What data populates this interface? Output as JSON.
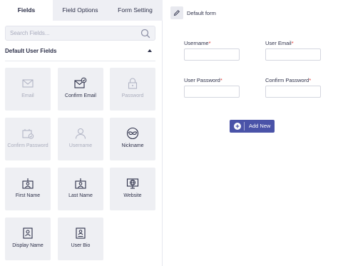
{
  "tabs": [
    {
      "label": "Fields",
      "active": true
    },
    {
      "label": "Field Options",
      "active": false
    },
    {
      "label": "Form Setting",
      "active": false
    }
  ],
  "search": {
    "placeholder": "Search Fields...",
    "value": "",
    "icon": "search-icon"
  },
  "section": {
    "title": "Default User Fields",
    "toggle_icon": "caret-up-icon"
  },
  "fields": [
    {
      "label": "Email",
      "icon": "envelope-icon",
      "disabled": true
    },
    {
      "label": "Confirm Email",
      "icon": "envelope-check-icon",
      "disabled": false
    },
    {
      "label": "Password",
      "icon": "lock-icon",
      "disabled": true
    },
    {
      "label": "Confirm Password",
      "icon": "id-card-check-icon",
      "disabled": true
    },
    {
      "label": "Username",
      "icon": "user-icon",
      "disabled": true
    },
    {
      "label": "Nickname",
      "icon": "mask-icon",
      "disabled": false
    },
    {
      "label": "First Name",
      "icon": "id-badge-icon",
      "disabled": false
    },
    {
      "label": "Last Name",
      "icon": "id-badge-icon",
      "disabled": false
    },
    {
      "label": "Website",
      "icon": "globe-monitor-icon",
      "disabled": false
    },
    {
      "label": "Display Name",
      "icon": "portrait-icon",
      "disabled": false
    },
    {
      "label": "User Bio",
      "icon": "bio-card-icon",
      "disabled": false
    }
  ],
  "form": {
    "name": "Default form",
    "edit_icon": "pencil-icon",
    "required_mark": "*",
    "fields": [
      {
        "label": "Username",
        "value": ""
      },
      {
        "label": "User Email",
        "value": ""
      },
      {
        "label": "User Password",
        "value": ""
      },
      {
        "label": "Confirm Password",
        "value": ""
      }
    ]
  },
  "add_button": {
    "label": "Add New",
    "icon": "plus-circle-icon"
  },
  "colors": {
    "accent": "#4a53a8",
    "required": "#e5322d",
    "tile_bg": "#eeeff3",
    "tab_bg": "#eeeff4"
  }
}
